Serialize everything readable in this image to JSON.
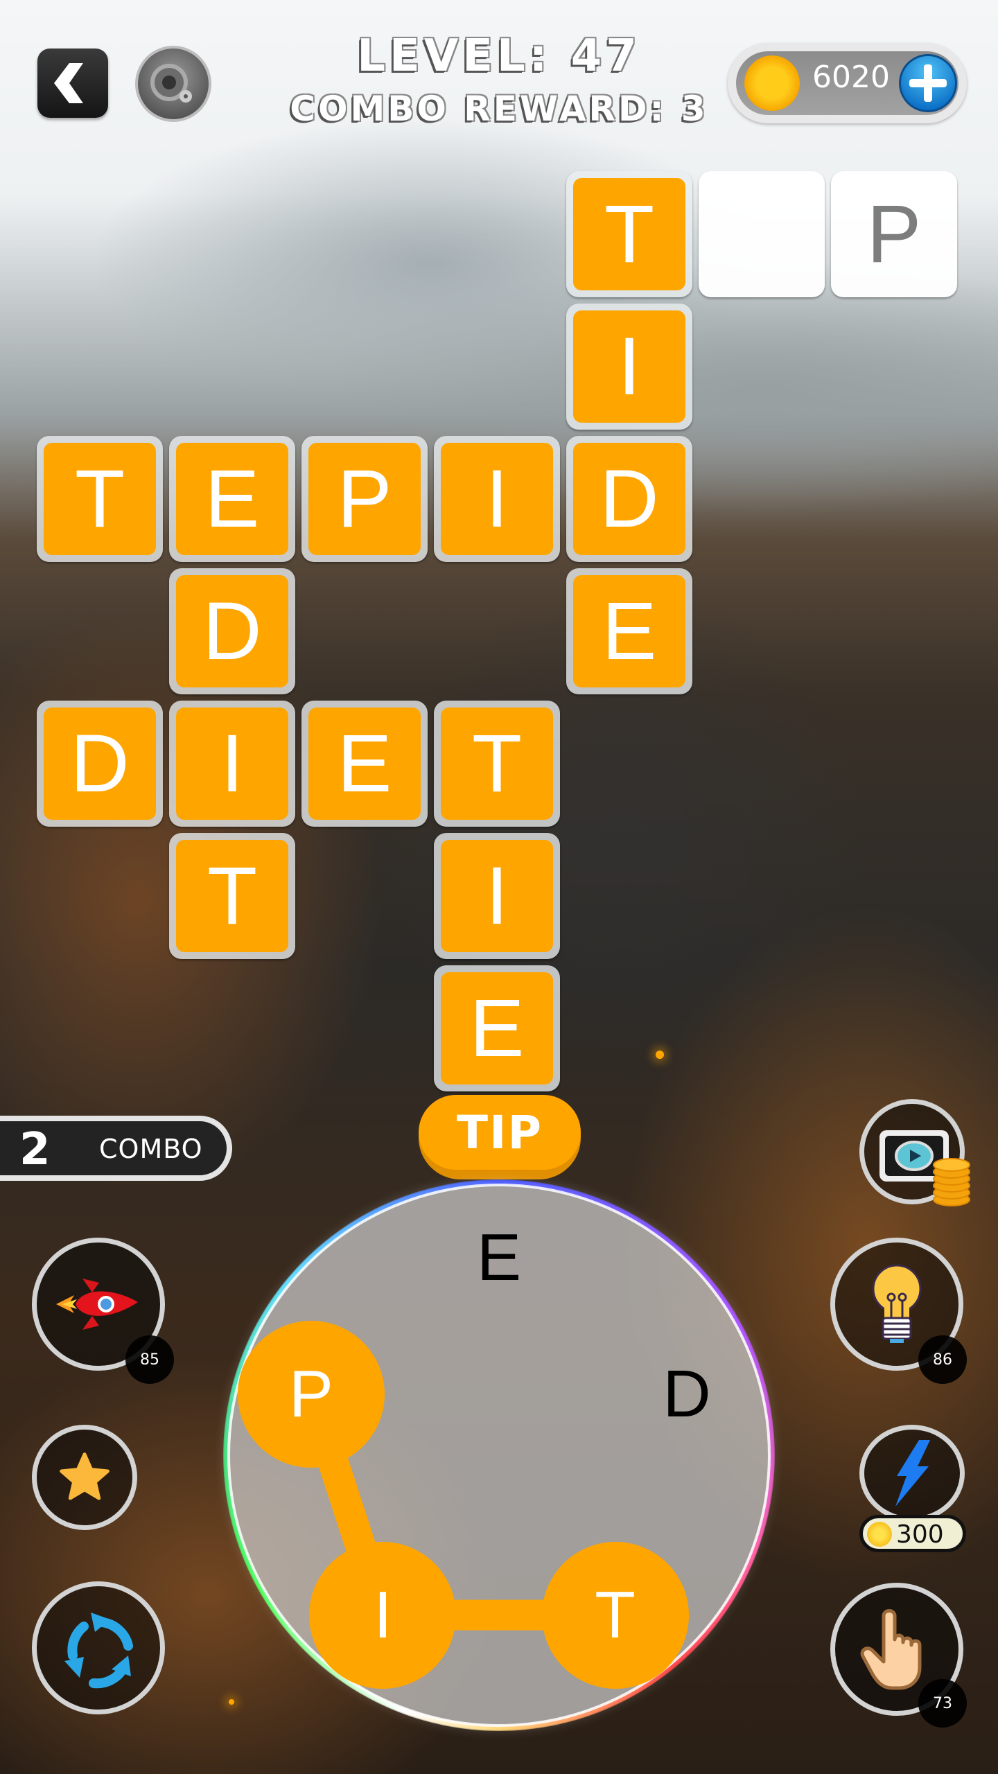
{
  "header": {
    "level_text": "LEVEL: 47",
    "combo_reward_text": "COMBO REWARD: 3",
    "coins": "6020",
    "icons": {
      "back": "back-chevron-icon",
      "settings": "gear-icon",
      "coin": "coin-icon",
      "add": "plus-icon"
    }
  },
  "grid": {
    "tile_color": "#ffa500",
    "tiles": [
      {
        "col": 4,
        "row": 0,
        "letter": "T",
        "revealed": true
      },
      {
        "col": 5,
        "row": 0,
        "letter": "",
        "revealed": false
      },
      {
        "col": 6,
        "row": 0,
        "letter": "P",
        "revealed": false
      },
      {
        "col": 4,
        "row": 1,
        "letter": "I",
        "revealed": true
      },
      {
        "col": 0,
        "row": 2,
        "letter": "T",
        "revealed": true
      },
      {
        "col": 1,
        "row": 2,
        "letter": "E",
        "revealed": true
      },
      {
        "col": 2,
        "row": 2,
        "letter": "P",
        "revealed": true
      },
      {
        "col": 3,
        "row": 2,
        "letter": "I",
        "revealed": true
      },
      {
        "col": 4,
        "row": 2,
        "letter": "D",
        "revealed": true
      },
      {
        "col": 1,
        "row": 3,
        "letter": "D",
        "revealed": true
      },
      {
        "col": 4,
        "row": 3,
        "letter": "E",
        "revealed": true
      },
      {
        "col": 0,
        "row": 4,
        "letter": "D",
        "revealed": true
      },
      {
        "col": 1,
        "row": 4,
        "letter": "I",
        "revealed": true
      },
      {
        "col": 2,
        "row": 4,
        "letter": "E",
        "revealed": true
      },
      {
        "col": 3,
        "row": 4,
        "letter": "T",
        "revealed": true
      },
      {
        "col": 1,
        "row": 5,
        "letter": "T",
        "revealed": true
      },
      {
        "col": 3,
        "row": 5,
        "letter": "I",
        "revealed": true
      },
      {
        "col": 3,
        "row": 6,
        "letter": "E",
        "revealed": true
      }
    ]
  },
  "combo": {
    "count": "2",
    "label": "COMBO"
  },
  "current_word": "TIP",
  "wheel": {
    "letters": [
      {
        "letter": "E",
        "angle_deg": 0,
        "selected": false
      },
      {
        "letter": "D",
        "angle_deg": 72,
        "selected": false
      },
      {
        "letter": "T",
        "angle_deg": 144,
        "selected": true
      },
      {
        "letter": "I",
        "angle_deg": 216,
        "selected": true
      },
      {
        "letter": "P",
        "angle_deg": 288,
        "selected": true
      }
    ],
    "path": [
      "P",
      "I",
      "T"
    ]
  },
  "left_buttons": [
    {
      "name": "rocket-booster",
      "icon": "rocket-icon",
      "count": "85"
    },
    {
      "name": "favorite",
      "icon": "star-icon"
    },
    {
      "name": "shuffle",
      "icon": "shuffle-icon"
    }
  ],
  "right_buttons": [
    {
      "name": "watch-video-coins",
      "icon": "video-coins-icon"
    },
    {
      "name": "hint",
      "icon": "lightbulb-icon",
      "count": "86"
    },
    {
      "name": "lightning-booster",
      "icon": "lightning-icon",
      "price": "300"
    },
    {
      "name": "finger-reveal",
      "icon": "pointing-hand-icon",
      "count": "73"
    }
  ]
}
